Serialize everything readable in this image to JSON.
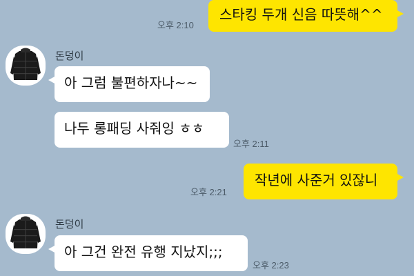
{
  "colors": {
    "background": "#a5bacd",
    "my_bubble": "#fee500",
    "their_bubble": "#ffffff",
    "timestamp": "#4c5b68"
  },
  "messages": [
    {
      "id": "m1",
      "sender": "me",
      "text": "스타킹 두개 신음 따뜻해^^",
      "time": "오후 2:10"
    },
    {
      "id": "m2",
      "sender": "돈덩이",
      "text": "아 그럼 불편하자나~~",
      "time": ""
    },
    {
      "id": "m3",
      "sender": "돈덩이",
      "text": "나두 롱패딩 사줘잉 ㅎㅎ",
      "time": "오후 2:11"
    },
    {
      "id": "m4",
      "sender": "me",
      "text": "작년에 사준거 있잖니",
      "time": "오후 2:21"
    },
    {
      "id": "m5",
      "sender": "돈덩이",
      "text": "아 그건 완전 유행 지났지;;;",
      "time": "오후 2:23"
    }
  ],
  "contact": {
    "name": "돈덩이",
    "avatar_icon": "black-padded-coat-icon"
  }
}
